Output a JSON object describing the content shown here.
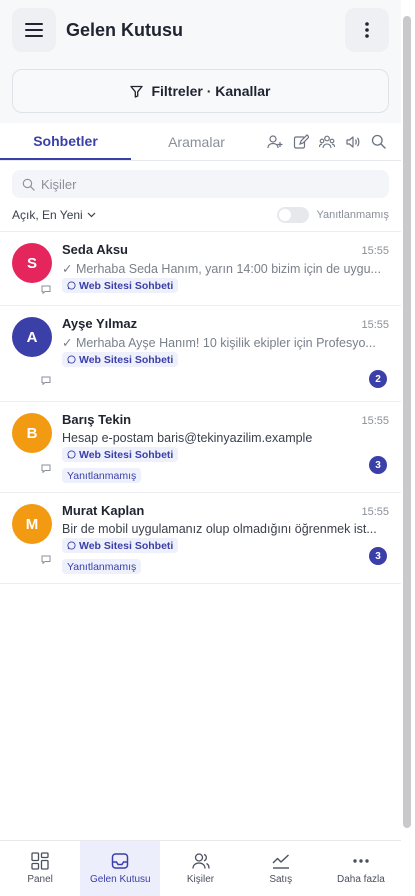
{
  "header": {
    "title": "Gelen Kutusu",
    "menu_icon": "hamburger-icon",
    "more_icon": "vertical-dots-icon"
  },
  "filter": {
    "label": "Filtreler · Kanallar",
    "icon": "filter-icon"
  },
  "tabs": [
    {
      "label": "Sohbetler",
      "active": true
    },
    {
      "label": "Aramalar",
      "active": false
    }
  ],
  "tab_icons": [
    "add-contact-icon",
    "compose-icon",
    "group-icon",
    "broadcast-icon",
    "search-icon"
  ],
  "search": {
    "placeholder": "Kişiler",
    "value": ""
  },
  "sort": {
    "label": "Açık, En Yeni"
  },
  "toggle": {
    "label": "Yanıtlanmamış",
    "on": false
  },
  "conversations": [
    {
      "initial": "S",
      "name": "Seda Aksu",
      "time": "15:55",
      "message": "✓ Merhaba Seda Hanım, yarın 14:00 bizim için de uygu...",
      "sent": true,
      "channel": "Web Sitesi Sohbeti",
      "unreplied": "",
      "unread": "",
      "avatar_color": "#e5265c"
    },
    {
      "initial": "A",
      "name": "Ayşe Yılmaz",
      "time": "15:55",
      "message": "✓ Merhaba Ayşe Hanım! 10 kişilik ekipler için Profesyo...",
      "sent": true,
      "channel": "Web Sitesi Sohbeti",
      "unreplied": "",
      "unread": "2",
      "avatar_color": "#3b3fa8"
    },
    {
      "initial": "B",
      "name": "Barış Tekin",
      "time": "15:55",
      "message": "Hesap e-postam baris@tekinyazilim.example",
      "sent": false,
      "channel": "Web Sitesi Sohbeti",
      "unreplied": "Yanıtlanmamış",
      "unread": "3",
      "avatar_color": "#f29a12"
    },
    {
      "initial": "M",
      "name": "Murat Kaplan",
      "time": "15:55",
      "message": "Bir de mobil uygulamanız olup olmadığını öğrenmek ist...",
      "sent": false,
      "channel": "Web Sitesi Sohbeti",
      "unreplied": "Yanıtlanmamış",
      "unread": "3",
      "avatar_color": "#f29a12"
    }
  ],
  "bottom_nav": [
    {
      "label": "Panel",
      "icon": "dashboard-icon",
      "active": false
    },
    {
      "label": "Gelen Kutusu",
      "icon": "inbox-icon",
      "active": true
    },
    {
      "label": "Kişiler",
      "icon": "contacts-icon",
      "active": false
    },
    {
      "label": "Satış",
      "icon": "sales-chart-icon",
      "active": false
    },
    {
      "label": "Daha fazla",
      "icon": "more-dots-icon",
      "active": false
    }
  ],
  "colors": {
    "accent": "#3b3fa8",
    "tag_bg": "#eef0fb",
    "page_bg": "#5a3fb8"
  }
}
